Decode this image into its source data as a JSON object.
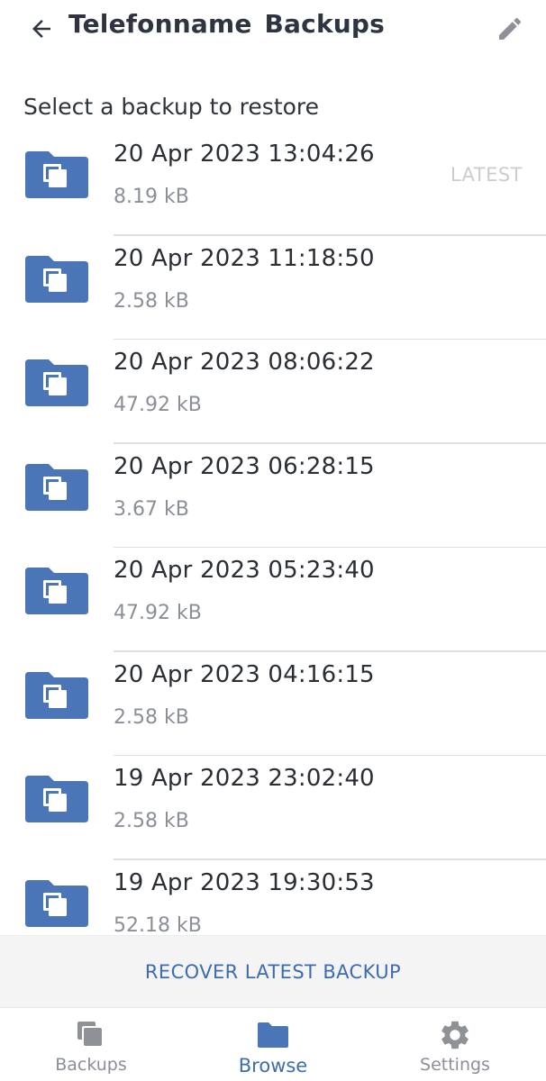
{
  "header": {
    "title_name": "Telefonname",
    "title_suffix": "Backups",
    "back_icon": "arrow-left-icon",
    "edit_icon": "pencil-icon"
  },
  "subtitle": "Select a backup to restore",
  "backups": [
    {
      "date": "20 Apr 2023 13:04:26",
      "size": "8.19 kB",
      "badge": "LATEST"
    },
    {
      "date": "20 Apr 2023 11:18:50",
      "size": "2.58 kB",
      "badge": ""
    },
    {
      "date": "20 Apr 2023 08:06:22",
      "size": "47.92 kB",
      "badge": ""
    },
    {
      "date": "20 Apr 2023 06:28:15",
      "size": "3.67 kB",
      "badge": ""
    },
    {
      "date": "20 Apr 2023 05:23:40",
      "size": "47.92 kB",
      "badge": ""
    },
    {
      "date": "20 Apr 2023 04:16:15",
      "size": "2.58 kB",
      "badge": ""
    },
    {
      "date": "19 Apr 2023 23:02:40",
      "size": "2.58 kB",
      "badge": ""
    },
    {
      "date": "19 Apr 2023 19:30:53",
      "size": "52.18 kB",
      "badge": ""
    }
  ],
  "recover_label": "RECOVER LATEST BACKUP",
  "nav": {
    "items": [
      {
        "label": "Backups",
        "icon": "copies-icon",
        "active": false
      },
      {
        "label": "Browse",
        "icon": "folder-icon",
        "active": true
      },
      {
        "label": "Settings",
        "icon": "gear-icon",
        "active": false
      }
    ]
  },
  "colors": {
    "accent": "#3d6db0",
    "folder": "#4a76b8",
    "text_primary": "#2a2e35",
    "text_secondary": "#8a8f98",
    "badge": "#c9cdd2",
    "divider": "#dcdfe3",
    "recover_bg": "#f4f4f5",
    "nav_inactive_icon": "#8e9196"
  }
}
